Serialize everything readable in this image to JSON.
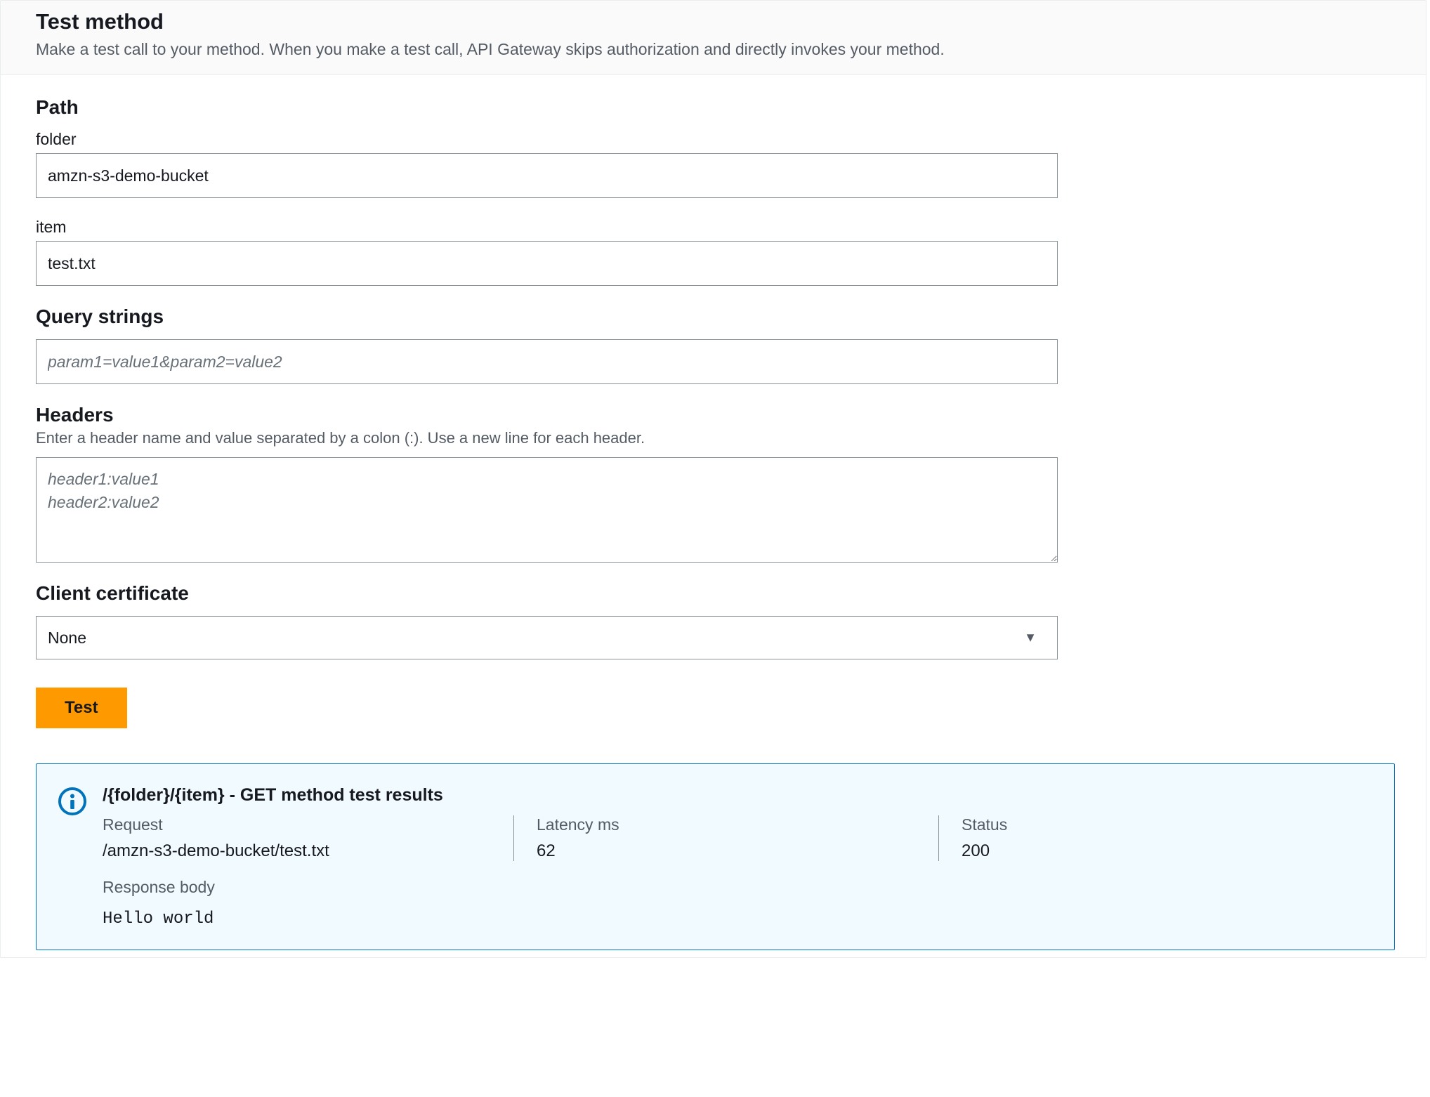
{
  "header": {
    "title": "Test method",
    "description": "Make a test call to your method. When you make a test call, API Gateway skips authorization and directly invokes your method."
  },
  "path": {
    "section_title": "Path",
    "fields": [
      {
        "label": "folder",
        "value": "amzn-s3-demo-bucket"
      },
      {
        "label": "item",
        "value": "test.txt"
      }
    ]
  },
  "query_strings": {
    "section_title": "Query strings",
    "placeholder": "param1=value1&param2=value2",
    "value": ""
  },
  "headers": {
    "section_title": "Headers",
    "description": "Enter a header name and value separated by a colon (:). Use a new line for each header.",
    "placeholder": "header1:value1\nheader2:value2",
    "value": ""
  },
  "client_certificate": {
    "section_title": "Client certificate",
    "selected": "None"
  },
  "actions": {
    "test_label": "Test"
  },
  "results": {
    "title": "/{folder}/{item} - GET method test results",
    "columns": {
      "request": {
        "label": "Request",
        "value": "/amzn-s3-demo-bucket/test.txt"
      },
      "latency": {
        "label": "Latency ms",
        "value": "62"
      },
      "status": {
        "label": "Status",
        "value": "200"
      }
    },
    "response_body": {
      "label": "Response body",
      "value": "Hello world"
    }
  }
}
